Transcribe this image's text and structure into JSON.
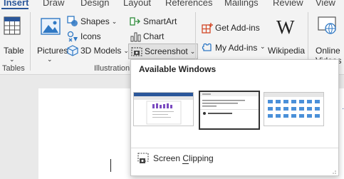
{
  "tabs": [
    "Insert",
    "Draw",
    "Design",
    "Layout",
    "References",
    "Mailings",
    "Review",
    "View"
  ],
  "active_tab": "Insert",
  "ribbon": {
    "table_label": "Table",
    "pictures_label": "Pictures",
    "shapes_label": "Shapes",
    "icons_label": "Icons",
    "models_label": "3D Models",
    "smartart_label": "SmartArt",
    "chart_label": "Chart",
    "screenshot_label": "Screenshot",
    "get_addins_label": "Get Add-ins",
    "my_addins_label": "My Add-ins",
    "wikipedia_label": "Wikipedia",
    "online_label": "Online",
    "videos_label": "Videos",
    "groups": {
      "tables": "Tables",
      "illustrations": "Illustration"
    }
  },
  "screenshot_menu": {
    "title": "Available Windows",
    "thumbnails": [
      {
        "name": "window-1",
        "selected": false
      },
      {
        "name": "window-2",
        "selected": true
      },
      {
        "name": "window-3",
        "selected": false
      }
    ],
    "clipping_prefix": "Screen ",
    "clipping_underlined": "C",
    "clipping_rest": "lipping"
  },
  "colors": {
    "accent": "#2b579a",
    "icon_blue": "#2f78c4",
    "icon_red": "#d24726",
    "ribbon_bg": "#f3f3f3",
    "doc_bg": "#e9e9e9"
  },
  "icons": [
    "table-icon",
    "pictures-icon",
    "shapes-icon",
    "icons-icon",
    "3d-models-icon",
    "smartart-icon",
    "chart-icon",
    "screenshot-icon",
    "get-addins-icon",
    "my-addins-icon",
    "wikipedia-icon",
    "online-video-icon",
    "screen-clipping-icon"
  ]
}
